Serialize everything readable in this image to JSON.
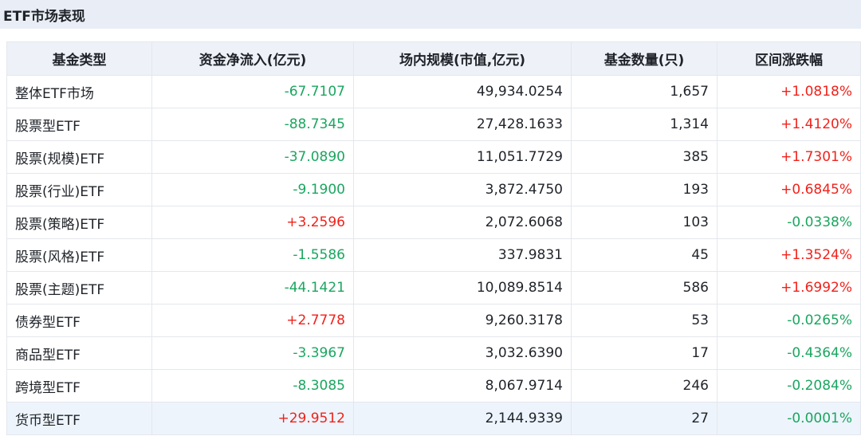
{
  "header": {
    "title": "ETF市场表现"
  },
  "table": {
    "columns": [
      "基金类型",
      "资金净流入(亿元)",
      "场内规模(市值,亿元)",
      "基金数量(只)",
      "区间涨跌幅"
    ],
    "rows": [
      {
        "type": "整体ETF市场",
        "net_inflow": "-67.7107",
        "scale": "49,934.0254",
        "count": "1,657",
        "change": "+1.0818%"
      },
      {
        "type": "股票型ETF",
        "net_inflow": "-88.7345",
        "scale": "27,428.1633",
        "count": "1,314",
        "change": "+1.4120%"
      },
      {
        "type": "股票(规模)ETF",
        "net_inflow": "-37.0890",
        "scale": "11,051.7729",
        "count": "385",
        "change": "+1.7301%"
      },
      {
        "type": "股票(行业)ETF",
        "net_inflow": "-9.1900",
        "scale": "3,872.4750",
        "count": "193",
        "change": "+0.6845%"
      },
      {
        "type": "股票(策略)ETF",
        "net_inflow": "+3.2596",
        "scale": "2,072.6068",
        "count": "103",
        "change": "-0.0338%"
      },
      {
        "type": "股票(风格)ETF",
        "net_inflow": "-1.5586",
        "scale": "337.9831",
        "count": "45",
        "change": "+1.3524%"
      },
      {
        "type": "股票(主题)ETF",
        "net_inflow": "-44.1421",
        "scale": "10,089.8514",
        "count": "586",
        "change": "+1.6992%"
      },
      {
        "type": "债券型ETF",
        "net_inflow": "+2.7778",
        "scale": "9,260.3178",
        "count": "53",
        "change": "-0.0265%"
      },
      {
        "type": "商品型ETF",
        "net_inflow": "-3.3967",
        "scale": "3,032.6390",
        "count": "17",
        "change": "-0.4364%"
      },
      {
        "type": "跨境型ETF",
        "net_inflow": "-8.3085",
        "scale": "8,067.9714",
        "count": "246",
        "change": "-0.2084%"
      },
      {
        "type": "货币型ETF",
        "net_inflow": "+29.9512",
        "scale": "2,144.9339",
        "count": "27",
        "change": "-0.0001%"
      }
    ]
  },
  "colors": {
    "positive": "#f0221b",
    "negative": "#1aa65f",
    "header_bg": "#e9eef6",
    "table_header_bg": "#eef2f8",
    "highlight_row_bg": "#eef4fc"
  }
}
